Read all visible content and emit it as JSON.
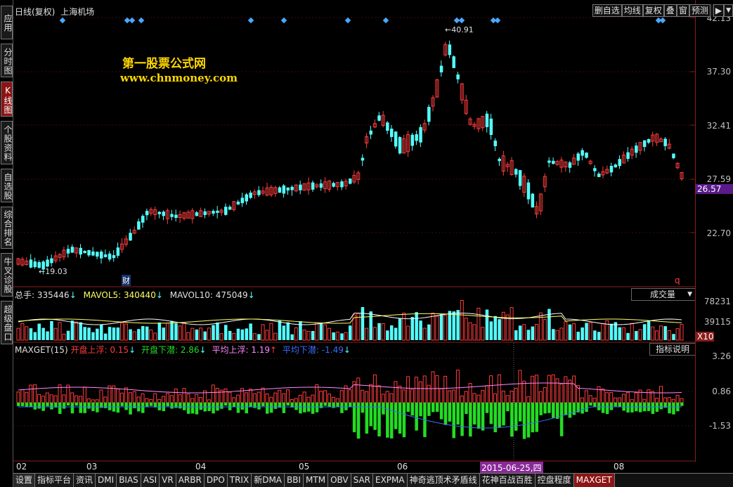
{
  "header": {
    "period_label": "日线(复权)",
    "stock_name": "上海机场"
  },
  "watermark": {
    "line1": "第一股票公式网",
    "line2": "www.chnmoney.com"
  },
  "toolbar": {
    "items": [
      "删自选",
      "均线",
      "复权",
      "叠",
      "窗",
      "预测"
    ],
    "arrow": "▶",
    "dropdown": "▼"
  },
  "left_tabs": [
    {
      "label": "应用",
      "active": false
    },
    {
      "label": "分时图",
      "active": false
    },
    {
      "label": "K线图",
      "active": true
    },
    {
      "label": "个股资料",
      "active": false
    },
    {
      "label": "自选股",
      "active": false
    },
    {
      "label": "综合排名",
      "active": false
    },
    {
      "label": "牛叉诊股",
      "active": false
    },
    {
      "label": "超级盘口",
      "active": false
    }
  ],
  "price_axis": {
    "ticks": [
      "42.13",
      "37.30",
      "32.41",
      "27.59",
      "22.70"
    ],
    "current": "26.57"
  },
  "kline": {
    "high_label": "40.91",
    "low_label": "19.03",
    "marker_cai": "财",
    "marker_q": "q"
  },
  "volume": {
    "label_total": "总手:",
    "total_value": "335446",
    "mavol5_label": "MAVOL5:",
    "mavol5_value": "340440",
    "mavol10_label": "MAVOL10:",
    "mavol10_value": "475049",
    "selector": "成交量",
    "ticks": [
      "78231",
      "39115"
    ],
    "unit": "X10"
  },
  "indicator": {
    "name": "MAXGET(15)",
    "kpsf_label": "开盘上浮:",
    "kpsf_value": "0.15",
    "kpxq_label": "开盘下潜:",
    "kpxq_value": "2.86",
    "pjsf_label": "平均上浮:",
    "pjsf_value": "1.19",
    "pjxq_label": "平均下潜:",
    "pjxq_value": "-1.49",
    "help_button": "指标说明",
    "ticks": [
      "3.26",
      "0.86",
      "-1.53"
    ]
  },
  "date_axis": {
    "months": [
      "02",
      "03",
      "04",
      "05",
      "06",
      "08"
    ],
    "cursor_date": "2015-06-25,四"
  },
  "bottom_tabs": [
    "设置",
    "指标平台",
    "资讯",
    "DMI",
    "BIAS",
    "ASI",
    "VR",
    "ARBR",
    "DPO",
    "TRIX",
    "新DMA",
    "BBI",
    "MTM",
    "OBV",
    "SAR",
    "EXPMA",
    "神奇逃顶术矛盾线",
    "花神百战百胜",
    "控盘程度",
    "MAXGET"
  ],
  "active_bottom_tab": "MAXGET",
  "colors": {
    "up": "#ff3c3c",
    "down": "#54ffff",
    "green": "#22dd22",
    "axis_red": "#8a1c1c",
    "accent_tab": "#8b1515",
    "purple": "#5a1a8a",
    "watermark": "#ffd700"
  }
}
